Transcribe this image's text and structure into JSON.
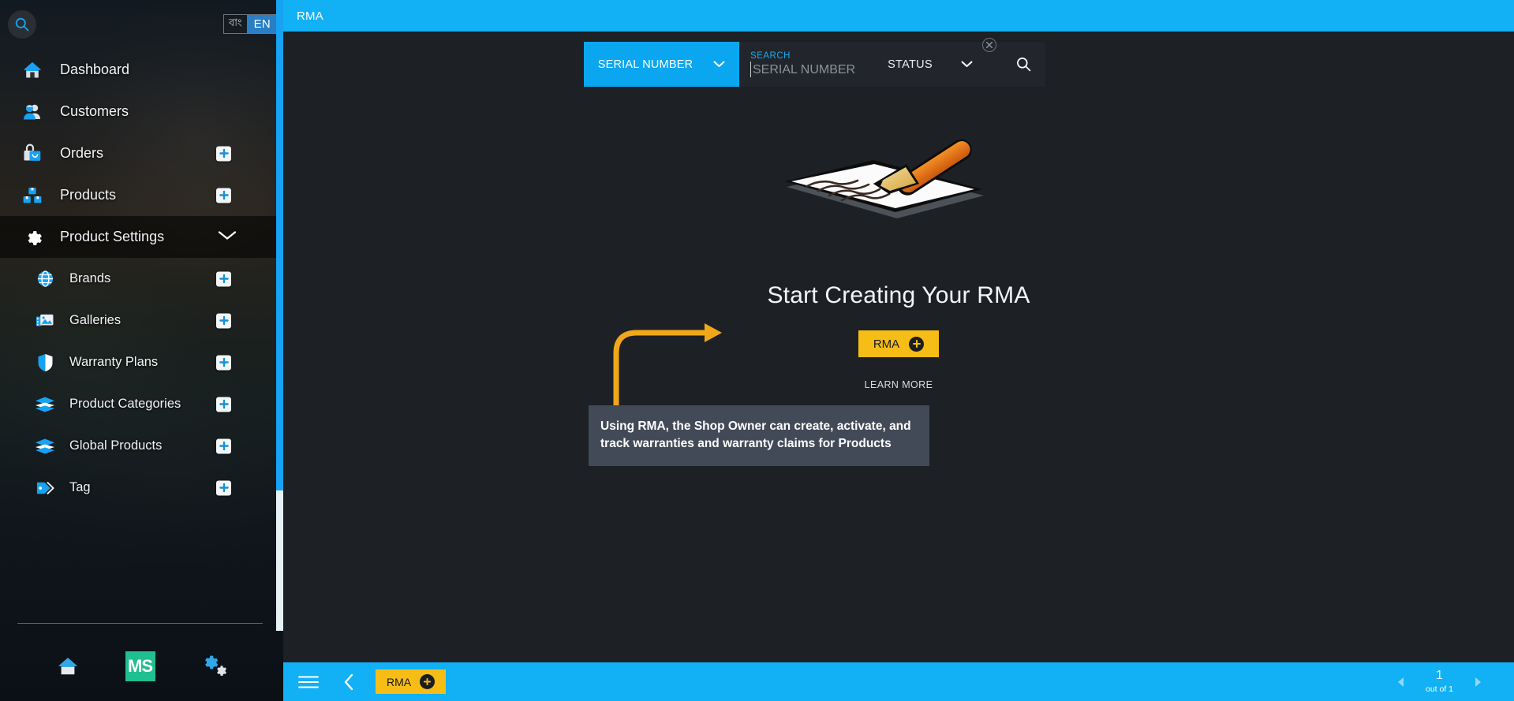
{
  "sidebar": {
    "search_icon": "search-icon",
    "language": {
      "alt_label": "বাং",
      "active_label": "EN"
    },
    "items": [
      {
        "label": "Dashboard",
        "icon": "home-icon",
        "has_add": false,
        "expandable": false,
        "active": false,
        "sub": false
      },
      {
        "label": "Customers",
        "icon": "customers-icon",
        "has_add": false,
        "expandable": false,
        "active": false,
        "sub": false
      },
      {
        "label": "Orders",
        "icon": "orders-bag-icon",
        "has_add": true,
        "expandable": false,
        "active": false,
        "sub": false
      },
      {
        "label": "Products",
        "icon": "products-boxes-icon",
        "has_add": true,
        "expandable": false,
        "active": false,
        "sub": false
      },
      {
        "label": "Product Settings",
        "icon": "gear-icon",
        "has_add": false,
        "expandable": true,
        "active": true,
        "sub": false
      },
      {
        "label": "Brands",
        "icon": "globe-icon",
        "has_add": true,
        "expandable": false,
        "active": false,
        "sub": true
      },
      {
        "label": "Galleries",
        "icon": "gallery-icon",
        "has_add": true,
        "expandable": false,
        "active": false,
        "sub": true
      },
      {
        "label": "Warranty Plans",
        "icon": "shield-icon",
        "has_add": true,
        "expandable": false,
        "active": false,
        "sub": true
      },
      {
        "label": "Product Categories",
        "icon": "layers-icon",
        "has_add": true,
        "expandable": false,
        "active": false,
        "sub": true
      },
      {
        "label": "Global Products",
        "icon": "layers-icon",
        "has_add": true,
        "expandable": false,
        "active": false,
        "sub": true
      },
      {
        "label": "Tag",
        "icon": "tag-icon",
        "has_add": true,
        "expandable": false,
        "active": false,
        "sub": true
      }
    ],
    "footer": [
      {
        "name": "home-button",
        "icon": "home-icon"
      },
      {
        "name": "ms-logo-button",
        "icon": "ms-logo",
        "label": "MS"
      },
      {
        "name": "settings-button",
        "icon": "gears-icon"
      }
    ]
  },
  "header": {
    "title": "RMA"
  },
  "filters": {
    "field_dropdown": {
      "value": "SERIAL NUMBER",
      "chevron": "chevron-down-icon"
    },
    "search": {
      "caption": "SEARCH",
      "value": "",
      "placeholder": "SERIAL NUMBER",
      "submit_icon": "search-icon"
    },
    "status_dropdown": {
      "value": "STATUS",
      "chevron": "chevron-down-icon"
    },
    "close": {
      "icon": "close-circle-icon"
    }
  },
  "empty_state": {
    "illustration": "pencil-writing-on-paper-illustration",
    "title": "Start Creating Your RMA",
    "cta": {
      "label": "RMA",
      "icon": "plus-circle-icon"
    },
    "learn_more": "LEARN MORE"
  },
  "tooltip": {
    "text": "Using RMA, the Shop Owner can create, activate, and track warranties and warranty claims for Products"
  },
  "bottom_bar": {
    "menu_icon": "hamburger-icon",
    "back_icon": "chevron-left-icon",
    "action": {
      "label": "RMA",
      "icon": "plus-circle-icon"
    },
    "pager": {
      "prev_icon": "triangle-left-icon",
      "page": "1",
      "total_label": "out of 1",
      "next_icon": "triangle-right-icon"
    }
  },
  "colors": {
    "accent_blue": "#12b0f5",
    "accent_yellow": "#f6bd17",
    "sidebar_dark": "#13181d",
    "main_bg": "#1d2126",
    "panel_bg": "#22262c",
    "tooltip_bg": "#434a57",
    "ms_green": "#20bf8f"
  }
}
